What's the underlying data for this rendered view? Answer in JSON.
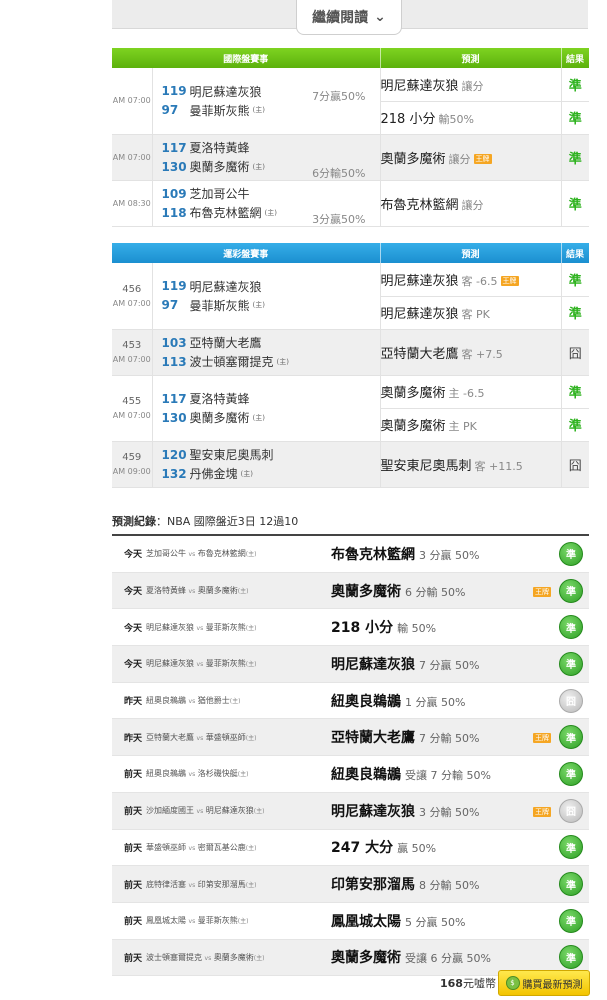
{
  "continue_label": "繼續閱讀",
  "intl_table": {
    "headers": [
      "國際盤賽事",
      "預測",
      "結果"
    ],
    "games": [
      {
        "time": "AM 07:00",
        "no": "",
        "away_no": "119",
        "away": "明尼蘇達灰狼",
        "home_no": "97",
        "home": "曼菲斯灰熊",
        "home_mark": "(主)",
        "odds": "7分贏50%",
        "picks": [
          {
            "text": "明尼蘇達灰狼",
            "sub": "讓分",
            "star": false,
            "result": "準"
          },
          {
            "text": "218 小分",
            "sub": "輸50%",
            "star": false,
            "result": "準"
          }
        ]
      },
      {
        "time": "AM 07:00",
        "no": "",
        "away_no": "117",
        "away": "夏洛特黃蜂",
        "home_no": "130",
        "home": "奧蘭多魔術",
        "home_mark": "(主)",
        "odds": "6分輸50%",
        "picks": [
          {
            "text": "奧蘭多魔術",
            "sub": "讓分",
            "star": true,
            "result": "準"
          }
        ]
      },
      {
        "time": "AM 08:30",
        "no": "",
        "away_no": "109",
        "away": "芝加哥公牛",
        "home_no": "118",
        "home": "布魯克林籃網",
        "home_mark": "(主)",
        "odds": "3分贏50%",
        "picks": [
          {
            "text": "布魯克林籃網",
            "sub": "讓分",
            "star": false,
            "result": "準"
          }
        ]
      }
    ]
  },
  "lottery_table": {
    "headers": [
      "運彩盤賽事",
      "預測",
      "結果"
    ],
    "games": [
      {
        "time": "AM 07:00",
        "no": "456",
        "away_no": "119",
        "away": "明尼蘇達灰狼",
        "home_no": "97",
        "home": "曼菲斯灰熊",
        "home_mark": "(主)",
        "picks": [
          {
            "text": "明尼蘇達灰狼",
            "sub": "客 -6.5",
            "star": true,
            "result": "準"
          },
          {
            "text": "明尼蘇達灰狼",
            "sub": "客 PK",
            "star": false,
            "result": "準"
          }
        ]
      },
      {
        "time": "AM 07:00",
        "no": "453",
        "away_no": "103",
        "away": "亞特蘭大老鷹",
        "home_no": "113",
        "home": "波士頓塞爾提克",
        "home_mark": "(主)",
        "picks": [
          {
            "text": "亞特蘭大老鷹",
            "sub": "客 +7.5",
            "star": false,
            "result": "囧"
          }
        ]
      },
      {
        "time": "AM 07:00",
        "no": "455",
        "away_no": "117",
        "away": "夏洛特黃蜂",
        "home_no": "130",
        "home": "奧蘭多魔術",
        "home_mark": "(主)",
        "picks": [
          {
            "text": "奧蘭多魔術",
            "sub": "主 -6.5",
            "star": false,
            "result": "準"
          },
          {
            "text": "奧蘭多魔術",
            "sub": "主 PK",
            "star": false,
            "result": "準"
          }
        ]
      },
      {
        "time": "AM 09:00",
        "no": "459",
        "away_no": "120",
        "away": "聖安東尼奧馬刺",
        "home_no": "132",
        "home": "丹佛金塊",
        "home_mark": "(主)",
        "picks": [
          {
            "text": "聖安東尼奧馬刺",
            "sub": "客 +11.5",
            "star": false,
            "result": "囧"
          }
        ]
      }
    ]
  },
  "record": {
    "title_bold": "預測紀錄",
    "title_rest": "：NBA 國際盤近3日 12過10",
    "vs": "vs",
    "rows": [
      {
        "day": "今天",
        "away": "芝加哥公牛",
        "home": "布魯克林籃網",
        "mark": "(主)",
        "pick": "布魯克林籃網",
        "detail": "3 分贏 50%",
        "star": false,
        "hit": true,
        "badge": "準"
      },
      {
        "day": "今天",
        "away": "夏洛特黃蜂",
        "home": "奧蘭多魔術",
        "mark": "(主)",
        "pick": "奧蘭多魔術",
        "detail": "6 分輸 50%",
        "star": true,
        "hit": true,
        "badge": "準"
      },
      {
        "day": "今天",
        "away": "明尼蘇達灰狼",
        "home": "曼菲斯灰熊",
        "mark": "(主)",
        "pick": "218 小分",
        "detail": "輸 50%",
        "star": false,
        "hit": true,
        "badge": "準"
      },
      {
        "day": "今天",
        "away": "明尼蘇達灰狼",
        "home": "曼菲斯灰熊",
        "mark": "(主)",
        "pick": "明尼蘇達灰狼",
        "detail": "7 分贏 50%",
        "star": false,
        "hit": true,
        "badge": "準"
      },
      {
        "day": "昨天",
        "away": "紐奧良鵜鶘",
        "home": "猶他爵士",
        "mark": "(主)",
        "pick": "紐奧良鵜鶘",
        "detail": "1 分贏 50%",
        "star": false,
        "hit": false,
        "badge": "囧"
      },
      {
        "day": "昨天",
        "away": "亞特蘭大老鷹",
        "home": "華盛頓巫師",
        "mark": "(主)",
        "pick": "亞特蘭大老鷹",
        "detail": "7 分輸 50%",
        "star": true,
        "hit": true,
        "badge": "準"
      },
      {
        "day": "前天",
        "away": "紐奧良鵜鶘",
        "home": "洛杉磯快艇",
        "mark": "(主)",
        "pick": "紐奧良鵜鶘",
        "detail": "受讓 7 分輸 50%",
        "star": false,
        "hit": true,
        "badge": "準"
      },
      {
        "day": "前天",
        "away": "沙加緬度國王",
        "home": "明尼蘇達灰狼",
        "mark": "(主)",
        "pick": "明尼蘇達灰狼",
        "detail": "3 分輸 50%",
        "star": true,
        "hit": false,
        "badge": "囧"
      },
      {
        "day": "前天",
        "away": "華盛頓巫師",
        "home": "密爾瓦基公鹿",
        "mark": "(主)",
        "pick": "247 大分",
        "detail": "贏 50%",
        "star": false,
        "hit": true,
        "badge": "準"
      },
      {
        "day": "前天",
        "away": "底特律活塞",
        "home": "印第安那溜馬",
        "mark": "(主)",
        "pick": "印第安那溜馬",
        "detail": "8 分輸 50%",
        "star": false,
        "hit": true,
        "badge": "準"
      },
      {
        "day": "前天",
        "away": "鳳凰城太陽",
        "home": "曼菲斯灰熊",
        "mark": "(主)",
        "pick": "鳳凰城太陽",
        "detail": "5 分贏 50%",
        "star": false,
        "hit": true,
        "badge": "準"
      },
      {
        "day": "前天",
        "away": "波士頓塞爾提克",
        "home": "奧蘭多魔術",
        "mark": "(主)",
        "pick": "奧蘭多魔術",
        "detail": "受讓 6 分贏 50%",
        "star": false,
        "hit": true,
        "badge": "準"
      }
    ]
  },
  "star_label": "王牌",
  "price": "168",
  "price_unit": "元",
  "currency": "噓幣",
  "buy_label": "購買最新預測",
  "coin_icon_text": "$",
  "colors": {
    "win": "#2db21d",
    "intl_header": "#6cc417",
    "lottery_header": "#2aa3e0",
    "buy_button": "#f8d81a"
  }
}
